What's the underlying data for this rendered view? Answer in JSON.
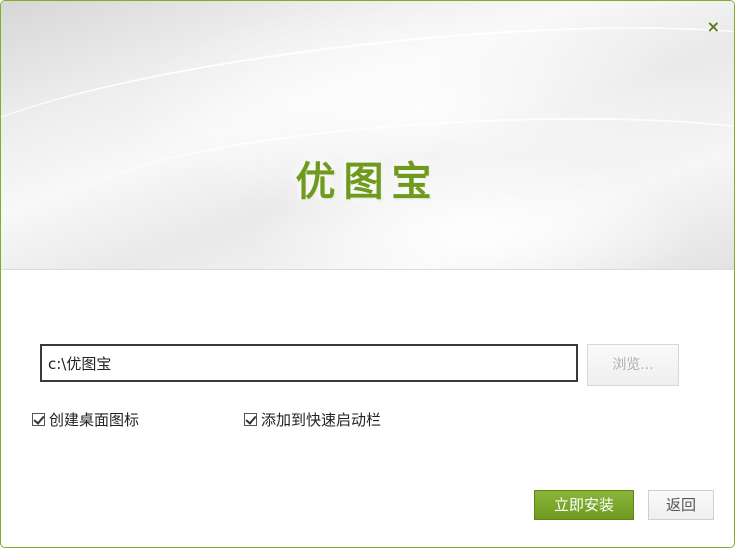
{
  "window": {
    "close_glyph": "×",
    "title": "优图宝"
  },
  "install": {
    "path_value": "c:\\优图宝",
    "browse_label": "浏览...",
    "options": [
      {
        "label": "创建桌面图标",
        "checked": true
      },
      {
        "label": "添加到快速启动栏",
        "checked": true
      }
    ],
    "install_button": "立即安装",
    "back_button": "返回"
  },
  "colors": {
    "accent": "#7fae2a",
    "title": "#6f9a1e"
  }
}
